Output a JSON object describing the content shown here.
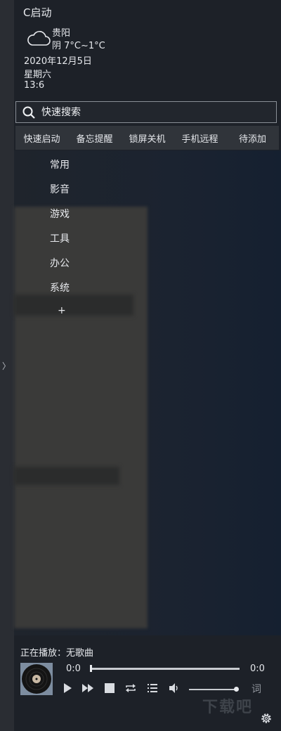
{
  "app": {
    "title": "C启动"
  },
  "sidebar": {
    "collapse_icon": "chevron-right-icon",
    "collapse_glyph": "〉"
  },
  "weather": {
    "icon": "cloud-icon",
    "city": "贵阳",
    "condition": "阴  7°C~1°C",
    "date": "2020年12月5日",
    "weekday": "星期六",
    "time": "13:6"
  },
  "search": {
    "placeholder": "快速搜索",
    "value": ""
  },
  "tabs": [
    {
      "label": "快速启动"
    },
    {
      "label": "备忘提醒"
    },
    {
      "label": "锁屏关机"
    },
    {
      "label": "手机远程"
    },
    {
      "label": "待添加"
    }
  ],
  "categories": [
    {
      "label": "常用"
    },
    {
      "label": "影音"
    },
    {
      "label": "游戏"
    },
    {
      "label": "工具"
    },
    {
      "label": "办公"
    },
    {
      "label": "系统"
    }
  ],
  "add_category": {
    "label": "+"
  },
  "player": {
    "now_playing": "正在播放：无歌曲",
    "current_time": "0:0",
    "total_time": "0:0",
    "progress": 0,
    "volume": 0.95,
    "lyrics_label": "词",
    "controls": [
      "play-icon",
      "next-icon",
      "stop-icon",
      "repeat-icon",
      "playlist-icon",
      "volume-icon"
    ]
  },
  "settings": {
    "icon": "gear-icon"
  },
  "watermark": {
    "text": "下载吧"
  },
  "colors": {
    "background": "#1d2128",
    "tab_bar": "#30343a",
    "text": "#e6e8ec"
  }
}
